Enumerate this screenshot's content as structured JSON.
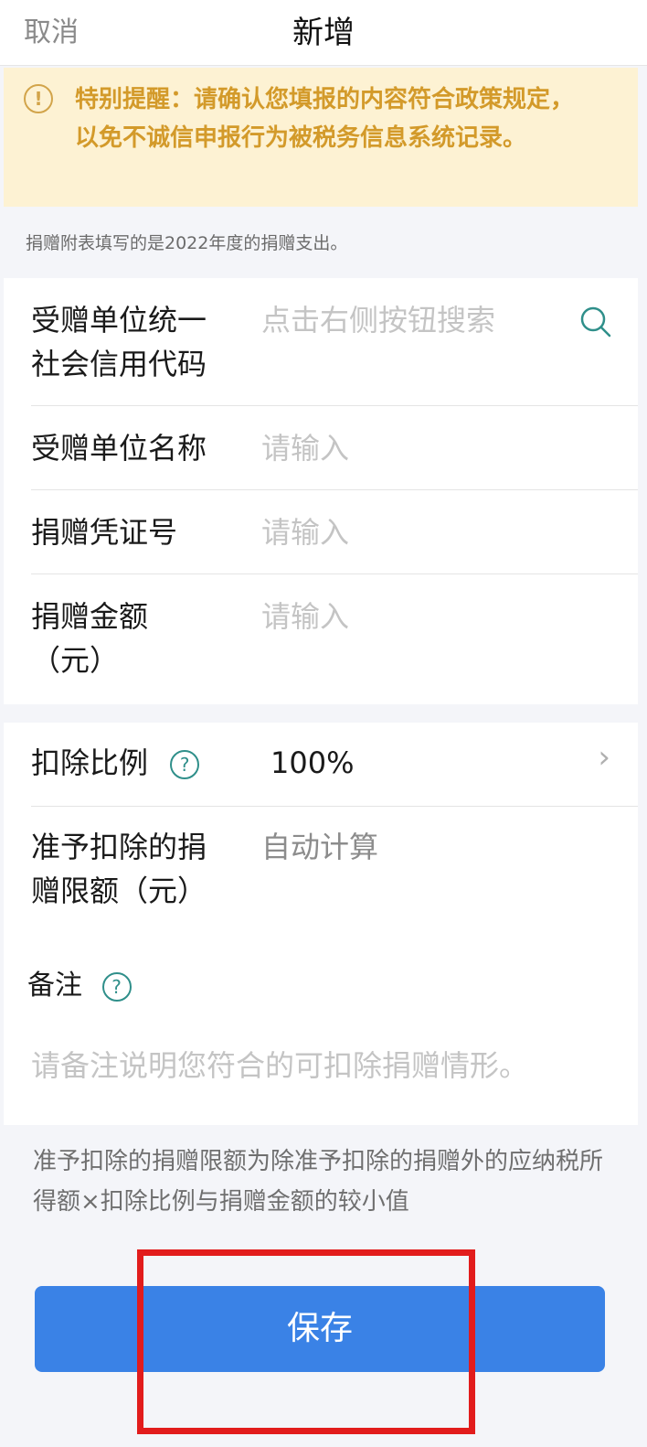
{
  "nav": {
    "cancel": "取消",
    "title": "新增"
  },
  "notice": {
    "text": "特别提醒：请确认您填报的内容符合政策规定，以免不诚信申报行为被税务信息系统记录。"
  },
  "info": "捐赠附表填写的是2022年度的捐赠支出。",
  "fields": {
    "credit_code": {
      "label": "受赠单位统一社会信用代码",
      "placeholder": "点击右侧按钮搜索"
    },
    "org_name": {
      "label": "受赠单位名称",
      "placeholder": "请输入"
    },
    "voucher": {
      "label": "捐赠凭证号",
      "placeholder": "请输入"
    },
    "amount": {
      "label_line1": "捐赠金额",
      "label_line2": "（元）",
      "placeholder": "请输入"
    },
    "ratio": {
      "label": "扣除比例",
      "value": "100%"
    },
    "limit": {
      "label": "准予扣除的捐赠限额（元）",
      "value": "自动计算"
    },
    "remark": {
      "label": "备注",
      "placeholder": "请备注说明您符合的可扣除捐赠情形。"
    }
  },
  "footnote": "准予扣除的捐赠限额为除准予扣除的捐赠外的应纳税所得额×扣除比例与捐赠金额的较小值",
  "save_label": "保存",
  "icons": {
    "notice": "exclamation-circle-icon",
    "search": "search-icon",
    "help": "question-circle-icon",
    "chevron": "chevron-right-icon"
  },
  "colors": {
    "primary": "#3a82e6",
    "notice_bg": "#fdf2d3",
    "notice_text": "#d39a2a",
    "highlight": "#e21c1c"
  },
  "glyphs": {
    "exclaim": "!",
    "question": "?",
    "chevron": "›"
  }
}
